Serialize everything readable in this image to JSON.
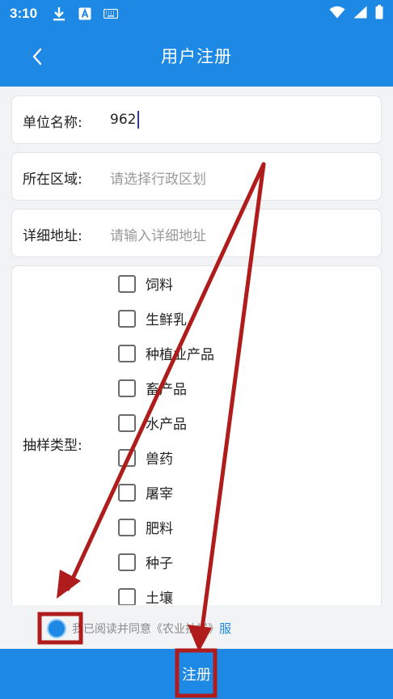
{
  "status_bar": {
    "time": "3:10",
    "icons": [
      "download-icon",
      "font-icon",
      "keyboard-icon",
      "wifi-icon",
      "signal-icon",
      "battery-icon"
    ]
  },
  "header": {
    "title": "用户注册",
    "back_icon": "chevron-left-icon"
  },
  "form": {
    "unit_name": {
      "label": "单位名称:",
      "value": "962"
    },
    "region": {
      "label": "所在区域:",
      "placeholder": "请选择行政区划"
    },
    "address": {
      "label": "详细地址:",
      "placeholder": "请输入详细地址"
    },
    "sampling": {
      "label": "抽样类型:",
      "options": [
        "饲料",
        "生鲜乳",
        "种植业产品",
        "畜产品",
        "水产品",
        "兽药",
        "屠宰",
        "肥料",
        "种子",
        "土壤"
      ]
    }
  },
  "agreement": {
    "text": "我已阅读并同意《农业抽样》",
    "link": "服"
  },
  "submit": {
    "label": "注册"
  },
  "colors": {
    "primary": "#1e88e5",
    "annotation": "#b01c1c"
  }
}
